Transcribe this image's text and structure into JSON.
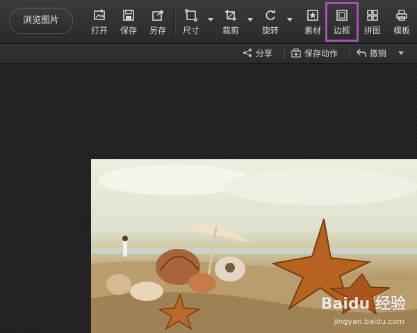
{
  "toolbar": {
    "browse_label": "浏览图片",
    "tools": [
      {
        "label": "打开",
        "icon": "open-image-icon"
      },
      {
        "label": "保存",
        "icon": "save-disk-icon"
      },
      {
        "label": "另存",
        "icon": "save-as-icon"
      },
      {
        "label": "尺寸",
        "icon": "resize-icon"
      },
      {
        "label": "裁剪",
        "icon": "crop-icon"
      },
      {
        "label": "旋转",
        "icon": "rotate-icon"
      },
      {
        "label": "素材",
        "icon": "star-material-icon"
      },
      {
        "label": "边框",
        "icon": "frame-border-icon"
      },
      {
        "label": "拼图",
        "icon": "puzzle-grid-icon"
      },
      {
        "label": "模板",
        "icon": "template-print-icon"
      }
    ],
    "highlight_color": "#a453b1"
  },
  "subbar": {
    "share_label": "分享",
    "save_action_label": "保存动作",
    "undo_label": "撤销"
  },
  "photo": {
    "watermark": "Baidu 经验",
    "watermark_sub": "jingyan.baidu.com"
  }
}
